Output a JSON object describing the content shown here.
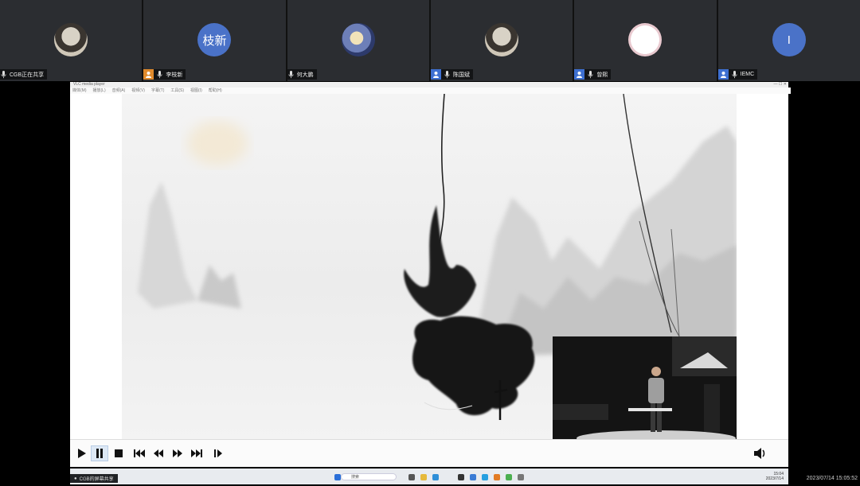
{
  "participants": [
    {
      "id": "p1",
      "avatar": "portrait",
      "initials": "",
      "name": "CGB正在共享",
      "badge": "none",
      "mic": "on"
    },
    {
      "id": "p2",
      "avatar": "blue",
      "initials": "枝新",
      "name": "李枝新",
      "badge": "orange",
      "mic": "on"
    },
    {
      "id": "p3",
      "avatar": "anime",
      "initials": "",
      "name": "何大鹏",
      "badge": "none",
      "mic": "on"
    },
    {
      "id": "p4",
      "avatar": "portrait",
      "initials": "",
      "name": "陈国斌",
      "badge": "blue",
      "mic": "on"
    },
    {
      "id": "p5",
      "avatar": "sketch",
      "initials": "",
      "name": "曾熙",
      "badge": "blue",
      "mic": "on"
    },
    {
      "id": "p6",
      "avatar": "blue",
      "initials": "I",
      "name": "IEMC",
      "badge": "blue",
      "mic": "on"
    }
  ],
  "window": {
    "title": "VLC media player",
    "menu": [
      "媒体(M)",
      "播放(L)",
      "音频(A)",
      "视频(V)",
      "字幕(T)",
      "工具(S)",
      "视图(I)",
      "帮助(H)"
    ]
  },
  "controls": {
    "buttons": [
      {
        "name": "play-button",
        "icon": "play-icon"
      },
      {
        "name": "pause-button",
        "icon": "pause-icon",
        "active": true
      },
      {
        "name": "stop-button",
        "icon": "stop-icon"
      },
      {
        "name": "previous-button",
        "icon": "skip-back-icon"
      },
      {
        "name": "rewind-button",
        "icon": "rewind-icon"
      },
      {
        "name": "fast-forward-button",
        "icon": "fast-forward-icon"
      },
      {
        "name": "next-button",
        "icon": "skip-forward-icon"
      },
      {
        "name": "frame-step-button",
        "icon": "frame-step-icon"
      }
    ],
    "volume_icon": "speaker-icon"
  },
  "taskbar": {
    "share_label": "CGB的屏幕共享",
    "search_placeholder": "搜索",
    "tray_time": "15:04",
    "tray_date": "2023/7/14"
  },
  "timestamp": "2023/07/14 15:05:52"
}
